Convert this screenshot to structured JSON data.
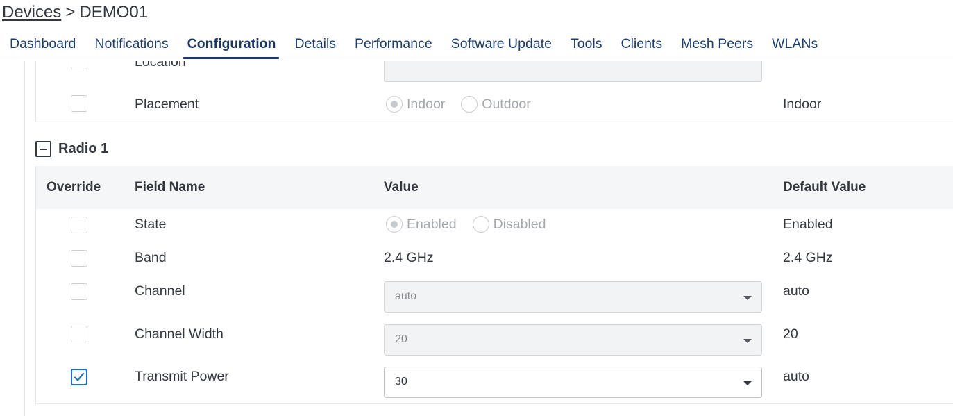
{
  "breadcrumb": {
    "root": "Devices",
    "separator": ">",
    "current": "DEMO01"
  },
  "tabs": [
    {
      "label": "Dashboard",
      "active": false
    },
    {
      "label": "Notifications",
      "active": false
    },
    {
      "label": "Configuration",
      "active": true
    },
    {
      "label": "Details",
      "active": false
    },
    {
      "label": "Performance",
      "active": false
    },
    {
      "label": "Software Update",
      "active": false
    },
    {
      "label": "Tools",
      "active": false
    },
    {
      "label": "Clients",
      "active": false
    },
    {
      "label": "Mesh Peers",
      "active": false
    },
    {
      "label": "WLANs",
      "active": false
    }
  ],
  "general_rows": {
    "location": {
      "field": "Location",
      "override": false,
      "value": "",
      "default": ""
    },
    "placement": {
      "field": "Placement",
      "override": false,
      "options": [
        "Indoor",
        "Outdoor"
      ],
      "selected": "Indoor",
      "default": "Indoor"
    }
  },
  "radio1": {
    "title": "Radio 1",
    "columns": {
      "override": "Override",
      "field": "Field Name",
      "value": "Value",
      "default": "Default Value"
    },
    "rows": {
      "state": {
        "field": "State",
        "override": false,
        "options": [
          "Enabled",
          "Disabled"
        ],
        "selected": "Enabled",
        "default": "Enabled"
      },
      "band": {
        "field": "Band",
        "override": false,
        "value": "2.4 GHz",
        "default": "2.4 GHz"
      },
      "channel": {
        "field": "Channel",
        "override": false,
        "value": "auto",
        "default": "auto"
      },
      "channel_width": {
        "field": "Channel Width",
        "override": false,
        "value": "20",
        "default": "20"
      },
      "transmit_power": {
        "field": "Transmit Power",
        "override": true,
        "value": "30",
        "default": "auto"
      }
    }
  },
  "colors": {
    "accent": "#1b3864",
    "checkbox_checked": "#1a6fc8",
    "header_bg": "#f5f6f8"
  }
}
